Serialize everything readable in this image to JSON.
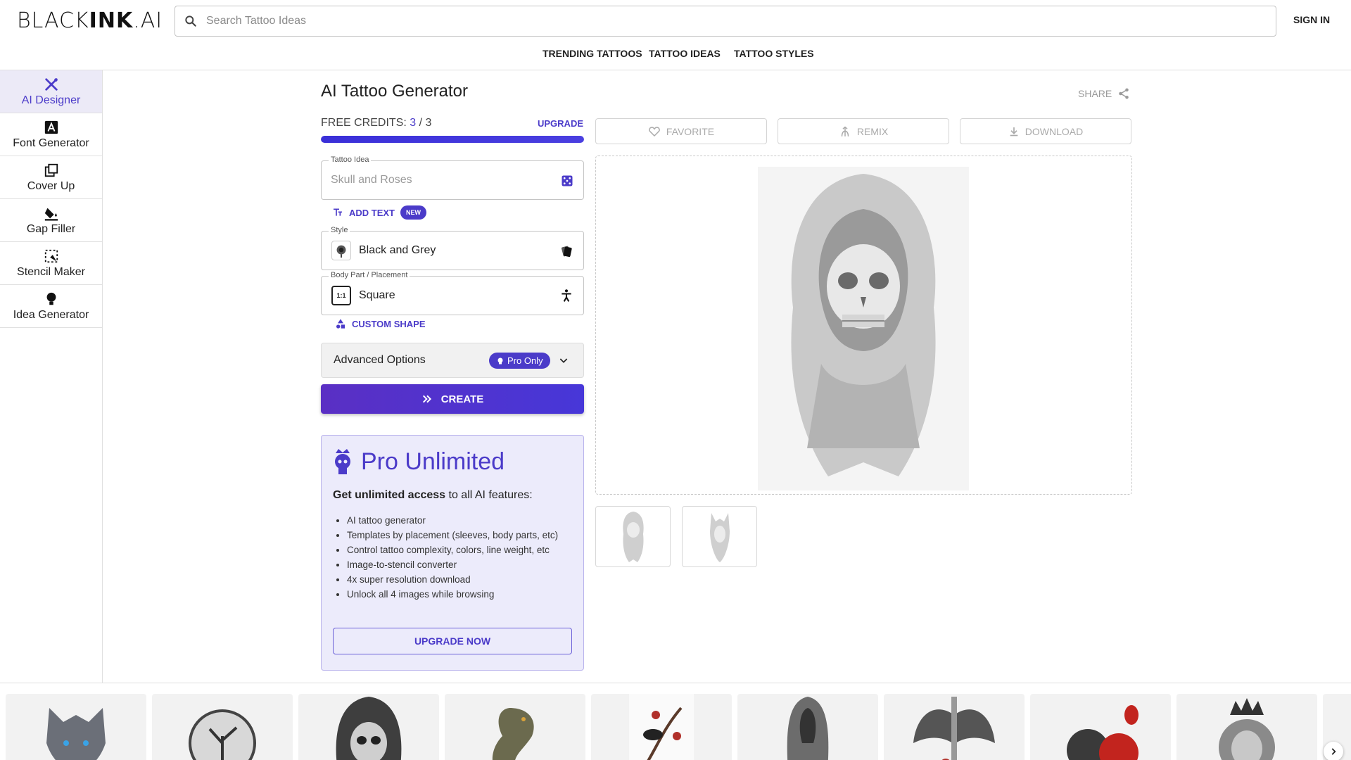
{
  "header": {
    "logo_light": "BLACK",
    "logo_bold": "INK",
    "logo_suffix": ".AI",
    "search_placeholder": "Search Tattoo Ideas",
    "sign_in": "SIGN IN",
    "nav": [
      "TRENDING TATTOOS",
      "TATTOO IDEAS",
      "TATTOO STYLES"
    ]
  },
  "sidebar": {
    "items": [
      {
        "label": "AI Designer",
        "icon": "ai-designer-icon",
        "active": true
      },
      {
        "label": "Font Generator",
        "icon": "font-icon",
        "active": false
      },
      {
        "label": "Cover Up",
        "icon": "cover-up-icon",
        "active": false
      },
      {
        "label": "Gap Filler",
        "icon": "paint-bucket-icon",
        "active": false
      },
      {
        "label": "Stencil Maker",
        "icon": "stencil-icon",
        "active": false
      },
      {
        "label": "Idea Generator",
        "icon": "lightbulb-icon",
        "active": false
      }
    ]
  },
  "main": {
    "title": "AI Tattoo Generator",
    "share": "SHARE",
    "credits_label": "FREE CREDITS:",
    "credits_used": "3",
    "credits_sep": " / ",
    "credits_total": "3",
    "credits_fraction": 1.0,
    "upgrade": "UPGRADE",
    "tattoo_idea": {
      "legend": "Tattoo Idea",
      "placeholder": "Skull and Roses"
    },
    "add_text": "ADD TEXT",
    "new_badge": "NEW",
    "style": {
      "legend": "Style",
      "value": "Black and Grey"
    },
    "placement": {
      "legend": "Body Part / Placement",
      "value": "Square",
      "thumb": "1:1"
    },
    "custom_shape": "CUSTOM SHAPE",
    "advanced": {
      "label": "Advanced Options",
      "chip": "Pro Only"
    },
    "create": "CREATE",
    "actions": {
      "favorite": "FAVORITE",
      "remix": "REMIX",
      "download": "DOWNLOAD"
    }
  },
  "pro_card": {
    "title": "Pro Unlimited",
    "desc_bold": "Get unlimited access",
    "desc_rest": " to all AI features:",
    "features": [
      "AI tattoo generator",
      "Templates by placement (sleeves, body parts, etc)",
      "Control tattoo complexity, colors, line weight, etc",
      "Image-to-stencil converter",
      "4x super resolution download",
      "Unlock all 4 images while browsing"
    ],
    "button": "UPGRADE NOW"
  },
  "colors": {
    "accent": "#4b3bc9",
    "accent_light": "#ecebfb"
  },
  "gallery": {
    "items": [
      "wolf-tattoo",
      "clock-tree-tattoo",
      "hooded-skull-tattoo",
      "dragon-tattoo",
      "raven-cherry-blossom-tattoo",
      "hooded-figure-tattoo",
      "winged-sword-tattoo",
      "rose-tattoo",
      "crowned-lion-tattoo"
    ]
  }
}
